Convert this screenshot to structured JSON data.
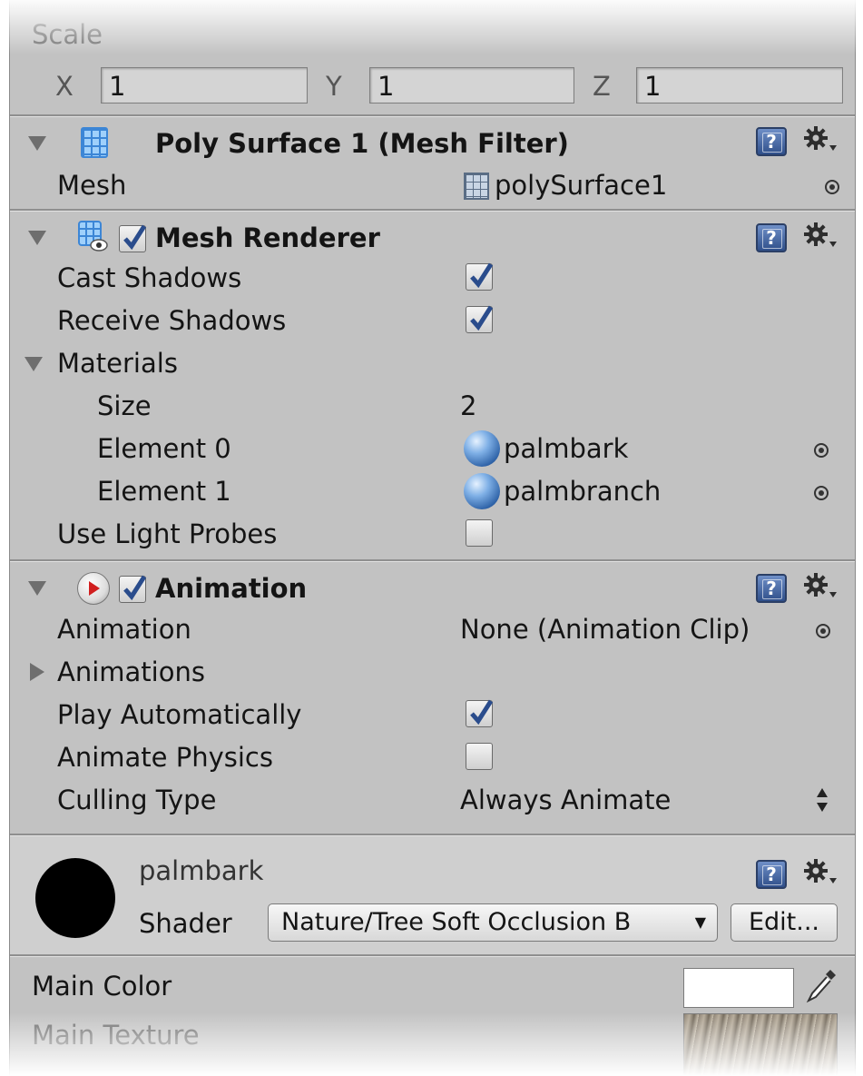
{
  "transform": {
    "scale_label": "Scale",
    "x_label": "X",
    "x_value": "1",
    "y_label": "Y",
    "y_value": "1",
    "z_label": "Z",
    "z_value": "1"
  },
  "mesh_filter": {
    "title": "Poly Surface 1 (Mesh Filter)",
    "mesh_label": "Mesh",
    "mesh_value": "polySurface1"
  },
  "mesh_renderer": {
    "title": "Mesh Renderer",
    "enabled": true,
    "cast_shadows_label": "Cast Shadows",
    "cast_shadows": true,
    "receive_shadows_label": "Receive Shadows",
    "receive_shadows": true,
    "materials_label": "Materials",
    "size_label": "Size",
    "size_value": "2",
    "elements": [
      {
        "label": "Element 0",
        "value": "palmbark"
      },
      {
        "label": "Element 1",
        "value": "palmbranch"
      }
    ],
    "use_light_probes_label": "Use Light Probes",
    "use_light_probes": false
  },
  "animation": {
    "title": "Animation",
    "enabled": true,
    "animation_label": "Animation",
    "animation_value": "None (Animation Clip)",
    "animations_label": "Animations",
    "play_automatically_label": "Play Automatically",
    "play_automatically": true,
    "animate_physics_label": "Animate Physics",
    "animate_physics": false,
    "culling_type_label": "Culling Type",
    "culling_type_value": "Always Animate"
  },
  "material": {
    "name": "palmbark",
    "shader_label": "Shader",
    "shader_value": "Nature/Tree Soft Occlusion B",
    "edit_button": "Edit...",
    "main_color_label": "Main Color",
    "main_texture_label": "Main Texture",
    "main_color": "#ffffff"
  },
  "icons": {
    "help": "help-book-icon",
    "gear": "gear-icon",
    "object_picker": "target-icon",
    "material": "sphere-icon",
    "mesh": "mesh-icon"
  }
}
